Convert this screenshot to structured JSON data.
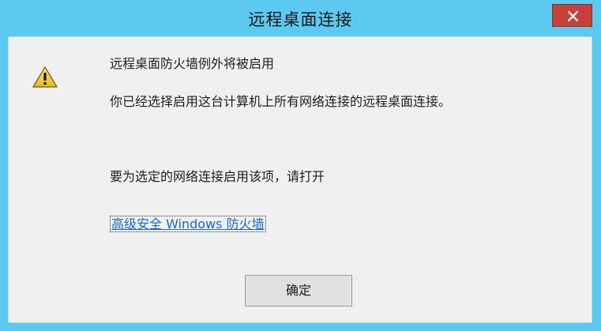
{
  "window": {
    "title": "远程桌面连接",
    "frame_color": "#5ccaf0",
    "close_color": "#c6413a"
  },
  "dialog": {
    "icon": "warning-icon",
    "heading": "远程桌面防火墙例外将被启用",
    "message": "你已经选择启用这台计算机上所有网络连接的远程桌面连接。",
    "instruction": "要为选定的网络连接启用该项，请打开",
    "link_text": "高级安全 Windows 防火墙",
    "ok_label": "确定"
  }
}
